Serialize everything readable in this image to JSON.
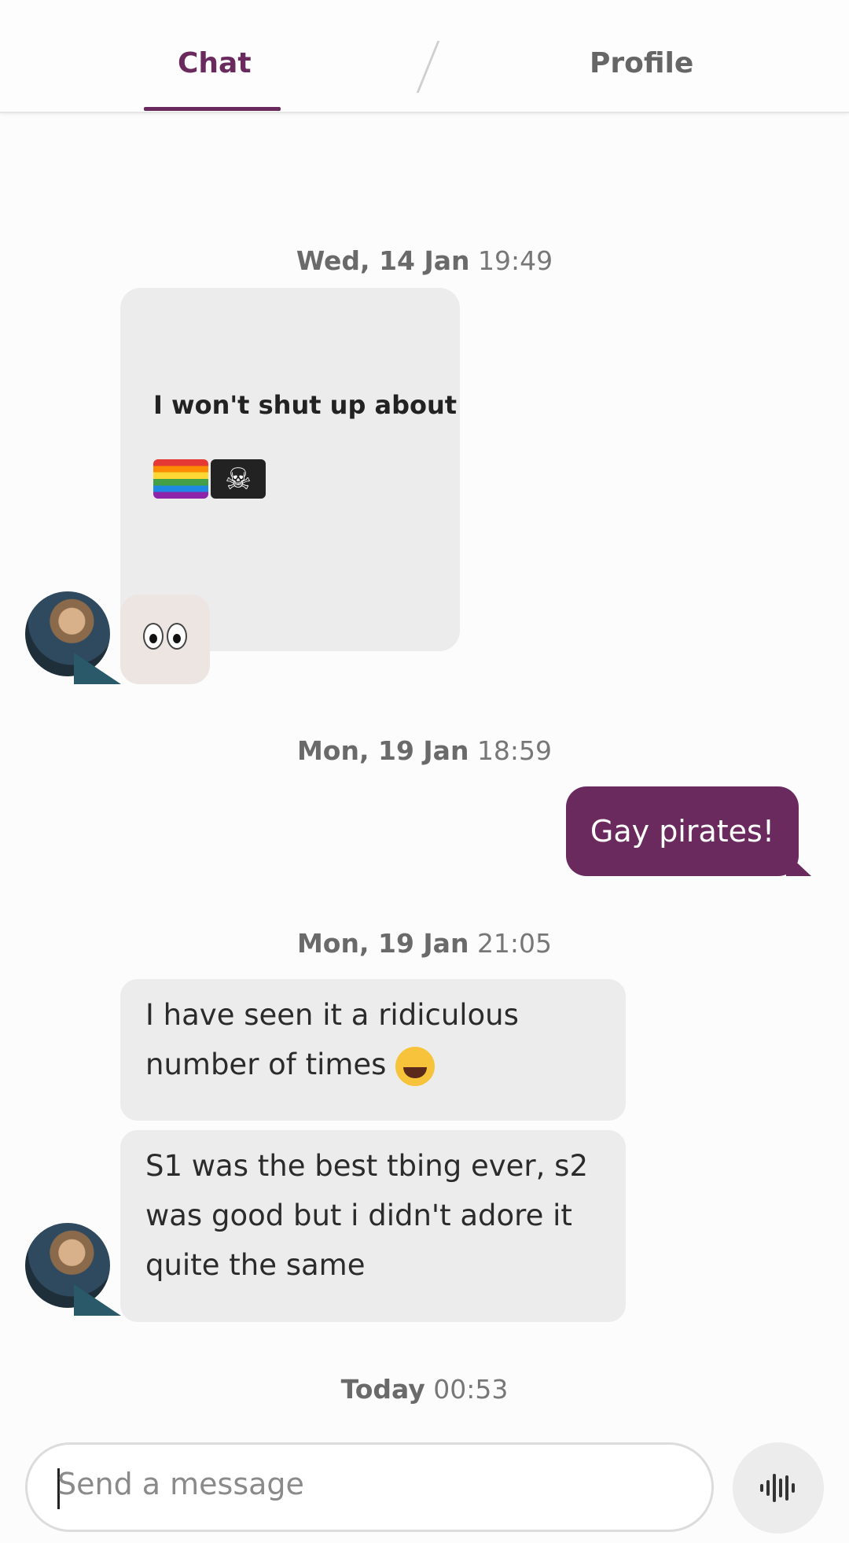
{
  "header": {
    "tab_chat": "Chat",
    "tab_profile": "Profile"
  },
  "messages": {
    "stamp1_day": "Wed, 14 Jan",
    "stamp1_time": "19:49",
    "card_text": "I won't shut up about",
    "stamp2_day": "Mon, 19 Jan",
    "stamp2_time": "18:59",
    "outgoing1": "Gay pirates!",
    "stamp3_day": "Mon, 19 Jan",
    "stamp3_time": "21:05",
    "incoming1": "I have seen it a ridiculous number of times",
    "incoming2": "S1 was the best tbing ever, s2 was good but i didn't adore it quite the same",
    "stamp4_day": "Today",
    "stamp4_time": "00:53"
  },
  "composer": {
    "placeholder": "Send a message"
  },
  "icons": {
    "voice": "audio-waveform-icon"
  },
  "colors": {
    "accent": "#6a2a5e",
    "bubble_incoming": "#ececed"
  }
}
